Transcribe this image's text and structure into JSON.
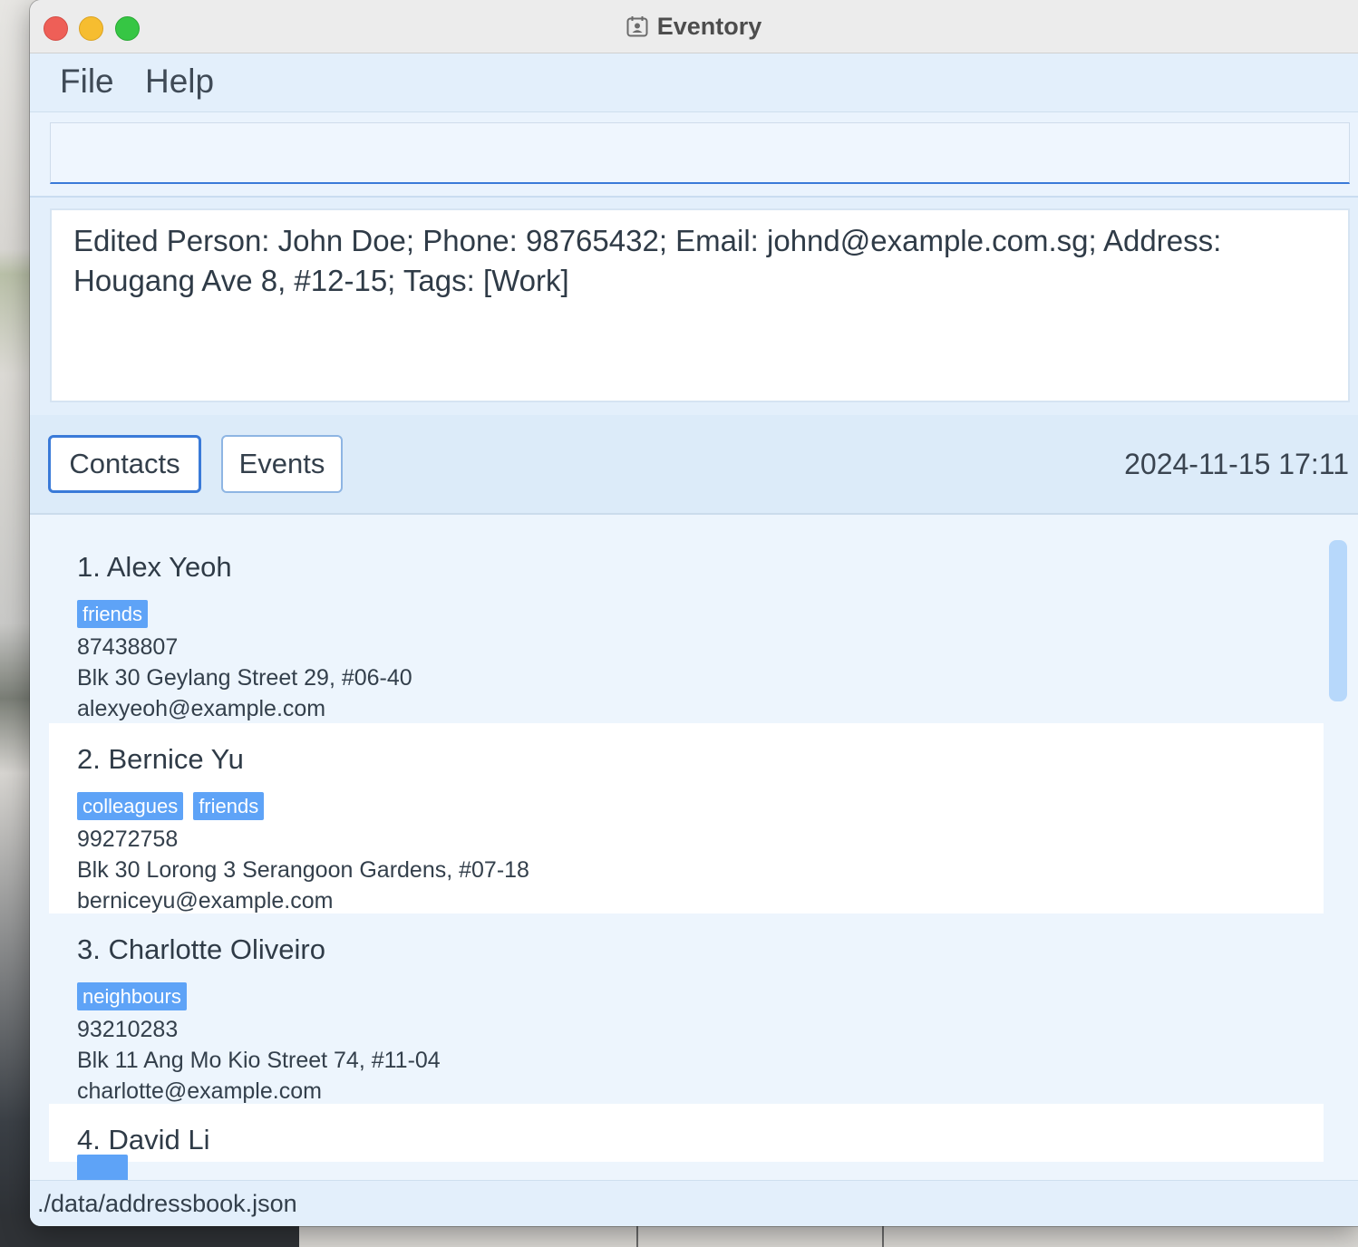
{
  "window": {
    "title": "Eventory",
    "icon": "calendar-contact-icon"
  },
  "menu": {
    "items": [
      "File",
      "Help"
    ]
  },
  "command": {
    "value": "",
    "placeholder": ""
  },
  "result": {
    "text": "Edited Person: John Doe; Phone: 98765432; Email: johnd@example.com.sg; Address: Hougang Ave 8, #12-15; Tags: [Work]"
  },
  "tabs": {
    "contacts_label": "Contacts",
    "events_label": "Events",
    "active": "Contacts"
  },
  "clock": "2024-11-15 17:11",
  "contacts": [
    {
      "name": "1. Alex Yeoh",
      "tags": [
        "friends"
      ],
      "phone": "87438807",
      "address": "Blk 30 Geylang Street 29, #06-40",
      "email": "alexyeoh@example.com"
    },
    {
      "name": "2. Bernice Yu",
      "tags": [
        "colleagues",
        "friends"
      ],
      "phone": "99272758",
      "address": "Blk 30 Lorong 3 Serangoon Gardens, #07-18",
      "email": "berniceyu@example.com"
    },
    {
      "name": "3. Charlotte Oliveiro",
      "tags": [
        "neighbours"
      ],
      "phone": "93210283",
      "address": "Blk 11 Ang Mo Kio Street 74, #11-04",
      "email": "charlotte@example.com"
    },
    {
      "name": "4. David Li",
      "tags": [],
      "phone": "",
      "address": "",
      "email": ""
    }
  ],
  "status": {
    "path": "./data/addressbook.json"
  },
  "colors": {
    "accent": "#3a7ad8",
    "tag": "#5ea3f7",
    "background": "#e3effb"
  }
}
